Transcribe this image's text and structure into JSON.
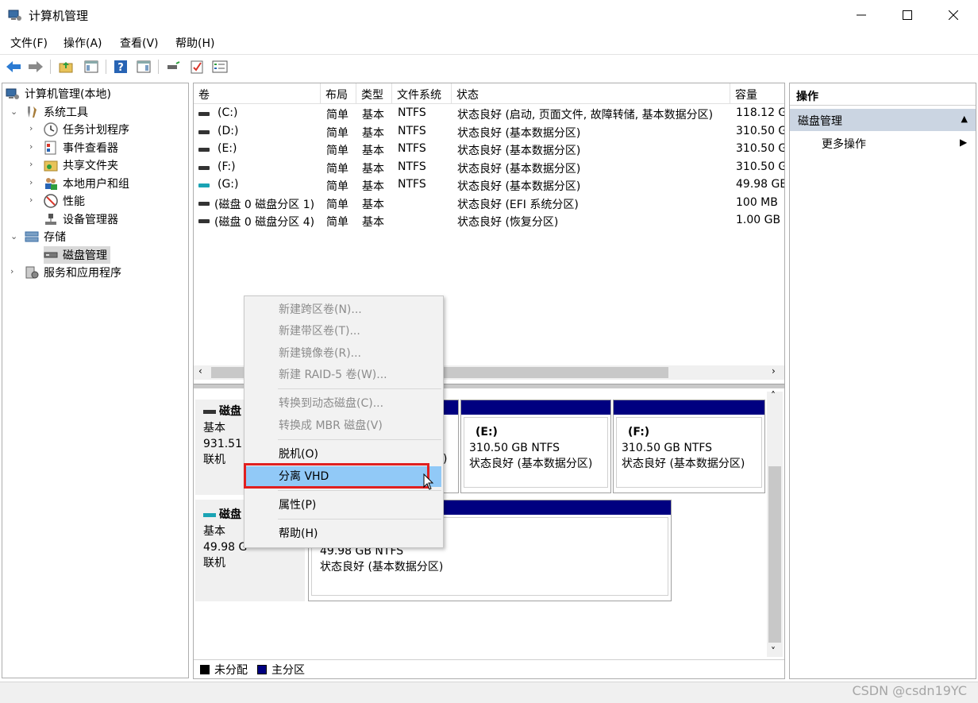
{
  "window": {
    "title": "计算机管理"
  },
  "menu": [
    "文件(F)",
    "操作(A)",
    "查看(V)",
    "帮助(H)"
  ],
  "tree": {
    "root": "计算机管理(本地)",
    "system_tools": "系统工具",
    "task_scheduler": "任务计划程序",
    "event_viewer": "事件查看器",
    "shared_folders": "共享文件夹",
    "local_users": "本地用户和组",
    "performance": "性能",
    "device_manager": "设备管理器",
    "storage": "存储",
    "disk_management": "磁盘管理",
    "services": "服务和应用程序"
  },
  "columns": [
    "卷",
    "布局",
    "类型",
    "文件系统",
    "状态",
    "容量"
  ],
  "volumes": [
    {
      "name": "(C:)",
      "layout": "简单",
      "type": "基本",
      "fs": "NTFS",
      "status": "状态良好 (启动, 页面文件, 故障转储, 基本数据分区)",
      "capacity": "118.12 G"
    },
    {
      "name": "(D:)",
      "layout": "简单",
      "type": "基本",
      "fs": "NTFS",
      "status": "状态良好 (基本数据分区)",
      "capacity": "310.50 G"
    },
    {
      "name": "(E:)",
      "layout": "简单",
      "type": "基本",
      "fs": "NTFS",
      "status": "状态良好 (基本数据分区)",
      "capacity": "310.50 G"
    },
    {
      "name": "(F:)",
      "layout": "简单",
      "type": "基本",
      "fs": "NTFS",
      "status": "状态良好 (基本数据分区)",
      "capacity": "310.50 G"
    },
    {
      "name": "(G:)",
      "layout": "简单",
      "type": "基本",
      "fs": "NTFS",
      "status": "状态良好 (基本数据分区)",
      "capacity": "49.98 GE"
    },
    {
      "name": "(磁盘 0 磁盘分区 1)",
      "layout": "简单",
      "type": "基本",
      "fs": "",
      "status": "状态良好 (EFI 系统分区)",
      "capacity": "100 MB"
    },
    {
      "name": "(磁盘 0 磁盘分区 4)",
      "layout": "简单",
      "type": "基本",
      "fs": "",
      "status": "状态良好 (恢复分区)",
      "capacity": "1.00 GB"
    }
  ],
  "disk0": {
    "name": "磁盘",
    "kind": "基本",
    "size": "931.51",
    "state": "联机",
    "partial_status_tail": ")",
    "partitions": [
      {
        "label": "(E:)",
        "size": "310.50 GB NTFS",
        "status": "状态良好 (基本数据分区)"
      },
      {
        "label": "(F:)",
        "size": "310.50 GB NTFS",
        "status": "状态良好 (基本数据分区)"
      }
    ]
  },
  "disk1": {
    "name": "磁盘",
    "kind": "基本",
    "size": "49.98 G",
    "state": "联机",
    "partition": {
      "size": "49.98 GB NTFS",
      "status": "状态良好 (基本数据分区)"
    }
  },
  "legend": {
    "unallocated": "未分配",
    "primary": "主分区"
  },
  "actions": {
    "header": "操作",
    "section": "磁盘管理",
    "more": "更多操作"
  },
  "context_menu": [
    {
      "label": "新建跨区卷(N)...",
      "enabled": false
    },
    {
      "label": "新建带区卷(T)...",
      "enabled": false
    },
    {
      "label": "新建镜像卷(R)...",
      "enabled": false
    },
    {
      "label": "新建 RAID-5 卷(W)...",
      "enabled": false
    },
    {
      "label": "转换到动态磁盘(C)...",
      "enabled": false
    },
    {
      "label": "转换成 MBR 磁盘(V)",
      "enabled": false
    },
    {
      "label": "脱机(O)",
      "enabled": true
    },
    {
      "label": "分离 VHD",
      "enabled": true,
      "highlighted": true
    },
    {
      "label": "属性(P)",
      "enabled": true
    },
    {
      "label": "帮助(H)",
      "enabled": true
    }
  ],
  "watermark": "CSDN @csdn19YC",
  "colors": {
    "primary_partition": "#000080",
    "unallocated": "#000000",
    "menu_highlight": "#91c9f7",
    "callout": "#e02020"
  }
}
